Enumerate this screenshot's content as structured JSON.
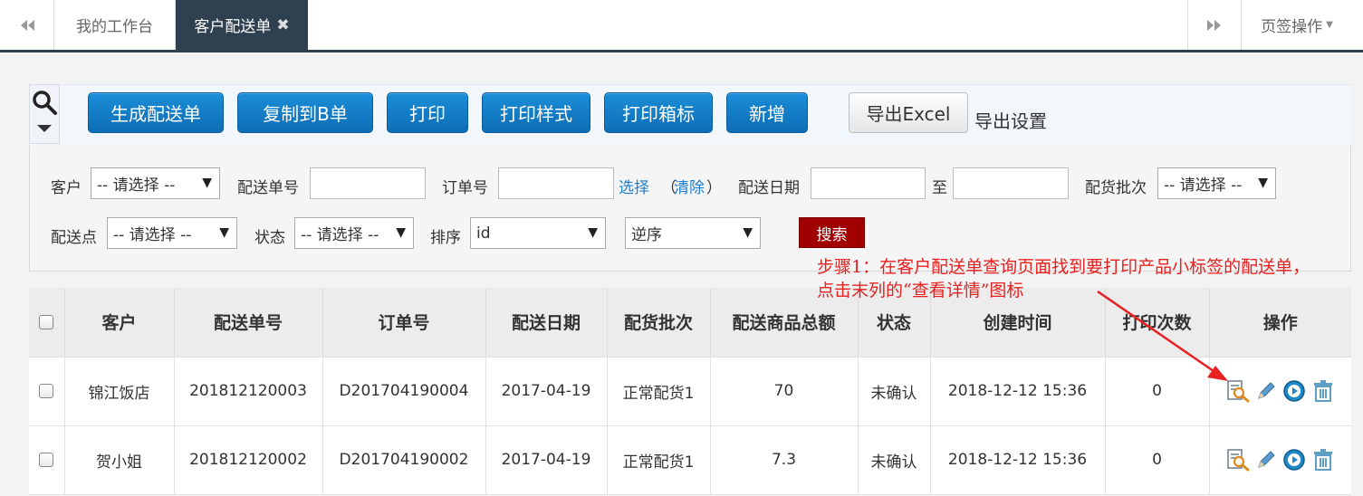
{
  "tabs": {
    "prev_icon": "double-chevron-left-icon",
    "items": [
      {
        "label": "我的工作台"
      },
      {
        "label": "客户配送单",
        "close": "✖"
      }
    ],
    "next_icon": "double-chevron-right-icon",
    "ops_label": "页签操作"
  },
  "toolbar": {
    "buttons": [
      "生成配送单",
      "复制到B单",
      "打印",
      "打印样式",
      "打印箱标",
      "新增"
    ],
    "export_label": "导出Excel",
    "export_settings": "导出设置"
  },
  "filters": {
    "customer_label": "客户",
    "customer_value": "-- 请选择 --",
    "delivery_no_label": "配送单号",
    "order_no_label": "订单号",
    "select_link": "选择",
    "clear_link": "清除",
    "paren_open": "（",
    "paren_close": "）",
    "date_label": "配送日期",
    "to_label": "至",
    "batch_label": "配货批次",
    "batch_value": "-- 请选择 --",
    "point_label": "配送点",
    "point_value": "-- 请选择 --",
    "status_label": "状态",
    "status_value": "-- 请选择 --",
    "sort_label": "排序",
    "sort_value": "id",
    "order_value": "逆序",
    "search_button": "搜索"
  },
  "annotation": {
    "line1": "步骤1：在客户配送单查询页面找到要打印产品小标签的配送单，",
    "line2": "点击末列的“查看详情”图标",
    "color": "#e82020"
  },
  "table": {
    "headers": [
      "客户",
      "配送单号",
      "订单号",
      "配送日期",
      "配货批次",
      "配送商品总额",
      "状态",
      "创建时间",
      "打印次数",
      "操作"
    ],
    "rows": [
      {
        "customer": "锦江饭店",
        "delivery_no": "201812120003",
        "order_no": "D201704190004",
        "date": "2017-04-19",
        "batch": "正常配货1",
        "total": "70",
        "status": "未确认",
        "created": "2018-12-12 15:36",
        "prints": "0"
      },
      {
        "customer": "贺小姐",
        "delivery_no": "201812120002",
        "order_no": "D201704190002",
        "date": "2017-04-19",
        "batch": "正常配货1",
        "total": "7.3",
        "status": "未确认",
        "created": "2018-12-12 15:36",
        "prints": "0"
      }
    ],
    "row_icons": [
      "view-details-icon",
      "edit-pencil-icon",
      "play-circle-icon",
      "trash-icon"
    ]
  }
}
